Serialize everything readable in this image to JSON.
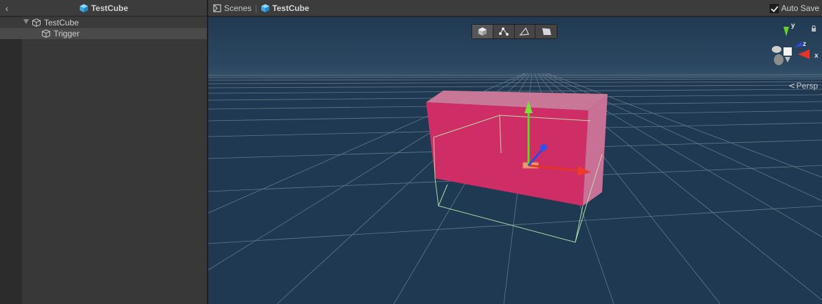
{
  "hierarchy": {
    "title": "TestCube",
    "items": [
      {
        "label": "TestCube",
        "icon": "gameobject-icon",
        "expanded": true
      },
      {
        "label": "Trigger",
        "icon": "gameobject-icon",
        "selected": true
      }
    ]
  },
  "scene": {
    "breadcrumbs": [
      {
        "label": "Scenes",
        "icon": "scenes-icon"
      },
      {
        "label": "TestCube",
        "icon": "prefab-cube-icon"
      }
    ],
    "auto_save_label": "Auto Save",
    "auto_save_checked": true,
    "toolbar": [
      {
        "name": "shaded-mode-icon",
        "active": true
      },
      {
        "name": "pivot-edit-icon",
        "active": false
      },
      {
        "name": "edge-mode-icon",
        "active": false
      },
      {
        "name": "face-mode-icon",
        "active": false
      }
    ],
    "gizmo_axes": {
      "y": "y",
      "z": "z",
      "x": "x"
    },
    "projection_label": "Persp"
  },
  "colors": {
    "sky": "#1f3952",
    "trigger_fill": "#cf2d66",
    "axis_x": "#e5332a",
    "axis_y": "#6ad12b",
    "axis_z": "#2f49e6",
    "selection_outline": "#b8f0b0",
    "accent": "#5ec3f0"
  }
}
